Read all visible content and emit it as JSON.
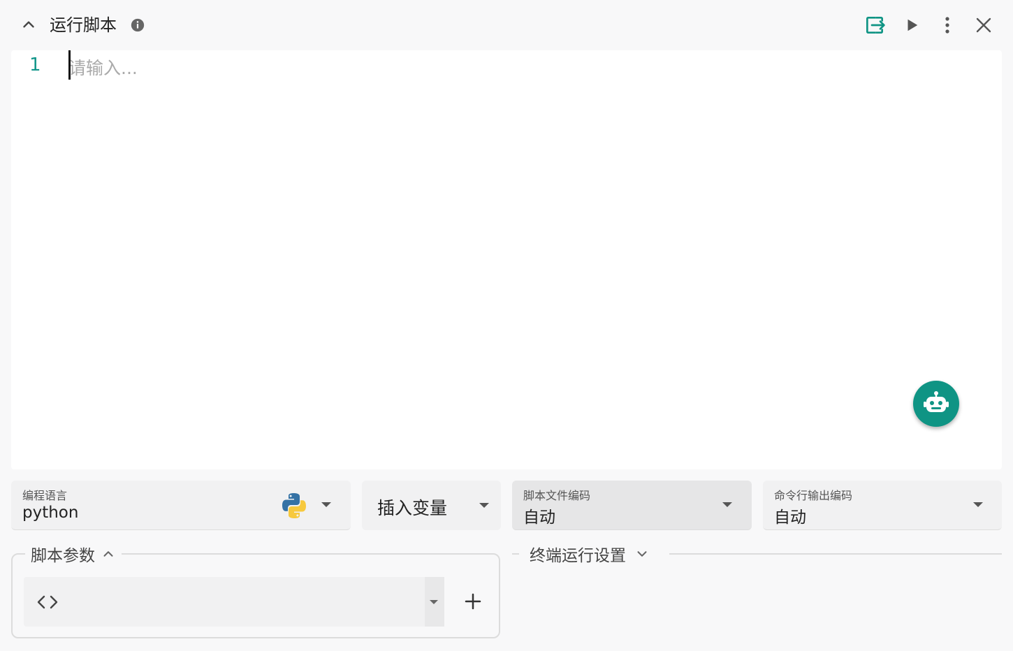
{
  "header": {
    "title": "运行脚本"
  },
  "editor": {
    "line_number": "1",
    "placeholder": "请输入..."
  },
  "fields": {
    "language": {
      "label": "编程语言",
      "value": "python"
    },
    "insert_variable": {
      "label": "插入变量"
    },
    "script_encoding": {
      "label": "脚本文件编码",
      "value": "自动"
    },
    "output_encoding": {
      "label": "命令行输出编码",
      "value": "自动"
    }
  },
  "script_args": {
    "legend": "脚本参数"
  },
  "terminal": {
    "legend": "终端运行设置"
  },
  "colors": {
    "accent": "#0f9484",
    "background": "#f8f8f9"
  },
  "icons": [
    "chevron-up-icon",
    "info-icon",
    "exit-to-app-icon",
    "play-icon",
    "more-vert-icon",
    "close-icon",
    "robot-icon",
    "python-logo-icon",
    "code-icon",
    "plus-icon",
    "chevron-down-icon"
  ]
}
